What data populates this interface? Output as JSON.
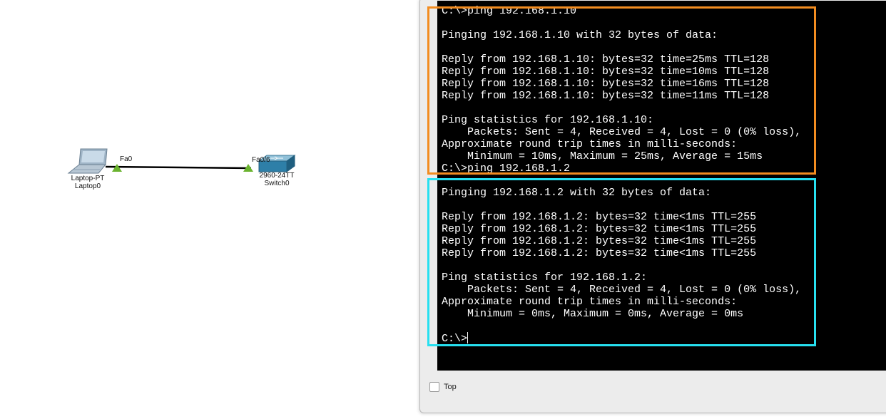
{
  "topology": {
    "laptop": {
      "model": "Laptop-PT",
      "name": "Laptop0",
      "port": "Fa0"
    },
    "switch": {
      "model": "2960-24TT",
      "name": "Switch0",
      "port": "Fa0/6"
    },
    "link_status_color": "#6ab32f"
  },
  "terminal": {
    "prompt": "C:\\>",
    "ping1": {
      "command": "C:\\>ping 192.168.1.10",
      "header": "Pinging 192.168.1.10 with 32 bytes of data:",
      "replies": [
        "Reply from 192.168.1.10: bytes=32 time=25ms TTL=128",
        "Reply from 192.168.1.10: bytes=32 time=10ms TTL=128",
        "Reply from 192.168.1.10: bytes=32 time=16ms TTL=128",
        "Reply from 192.168.1.10: bytes=32 time=11ms TTL=128"
      ],
      "stats_header": "Ping statistics for 192.168.1.10:",
      "packets": "    Packets: Sent = 4, Received = 4, Lost = 0 (0% loss),",
      "rtt_header": "Approximate round trip times in milli-seconds:",
      "rtt": "    Minimum = 10ms, Maximum = 25ms, Average = 15ms"
    },
    "ping2": {
      "command": "C:\\>ping 192.168.1.2",
      "header": "Pinging 192.168.1.2 with 32 bytes of data:",
      "replies": [
        "Reply from 192.168.1.2: bytes=32 time<1ms TTL=255",
        "Reply from 192.168.1.2: bytes=32 time<1ms TTL=255",
        "Reply from 192.168.1.2: bytes=32 time<1ms TTL=255",
        "Reply from 192.168.1.2: bytes=32 time<1ms TTL=255"
      ],
      "stats_header": "Ping statistics for 192.168.1.2:",
      "packets": "    Packets: Sent = 4, Received = 4, Lost = 0 (0% loss),",
      "rtt_header": "Approximate round trip times in milli-seconds:",
      "rtt": "    Minimum = 0ms, Maximum = 0ms, Average = 0ms"
    }
  },
  "controls": {
    "top_label": "Top",
    "top_checked": false
  },
  "colors": {
    "highlight_first": "#f28c20",
    "highlight_second": "#27e0f0",
    "terminal_bg": "#000000",
    "terminal_fg": "#ffffff"
  }
}
